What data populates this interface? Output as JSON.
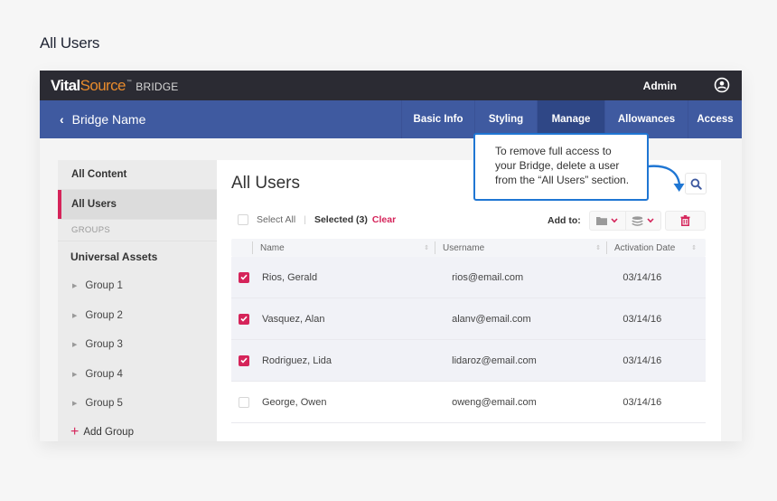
{
  "page": {
    "heading": "All Users"
  },
  "topbar": {
    "logo": {
      "vital": "Vital",
      "source": "Source",
      "tm": "™",
      "bridge": "BRIDGE"
    },
    "user_label": "Admin",
    "user_icon": "account-circle-icon"
  },
  "navbar": {
    "back_label": "Bridge Name",
    "back_icon": "chevron-left-icon",
    "tabs": [
      {
        "label": "Basic Info",
        "active": false
      },
      {
        "label": "Styling",
        "active": false
      },
      {
        "label": "Manage",
        "active": true
      },
      {
        "label": "Allowances",
        "active": false
      },
      {
        "label": "Access",
        "active": false
      }
    ]
  },
  "sidebar": {
    "all_content": "All Content",
    "all_users": "All Users",
    "groups_section": "GROUPS",
    "universal_assets": "Universal Assets",
    "groups": [
      "Group 1",
      "Group 2",
      "Group 3",
      "Group 4",
      "Group 5"
    ],
    "add_group": "Add Group",
    "accent": "#d5245a"
  },
  "main": {
    "title": "All Users",
    "selection": {
      "select_all": "Select All",
      "selected": "Selected (3)",
      "clear": "Clear"
    },
    "add_to_label": "Add to:",
    "icons": {
      "search": "search-icon",
      "folder": "folder-icon",
      "layers": "layers-icon",
      "trash": "trash-icon"
    },
    "columns": [
      "Name",
      "Username",
      "Activation Date"
    ],
    "rows": [
      {
        "name": "Rios, Gerald",
        "username": "rios@email.com",
        "date": "03/14/16",
        "checked": true
      },
      {
        "name": "Vasquez, Alan",
        "username": "alanv@email.com",
        "date": "03/14/16",
        "checked": true
      },
      {
        "name": "Rodriguez, Lida",
        "username": "lidaroz@email.com",
        "date": "03/14/16",
        "checked": true
      },
      {
        "name": "George, Owen",
        "username": "oweng@email.com",
        "date": "03/14/16",
        "checked": false
      }
    ]
  },
  "callout": {
    "lines": [
      "To remove full access to",
      "your Bridge, delete a user",
      "from the “All Users” section."
    ],
    "color": "#1f76d3"
  }
}
